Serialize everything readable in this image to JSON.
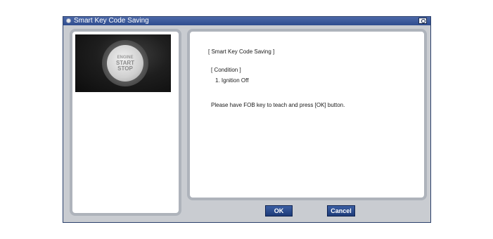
{
  "window": {
    "title": "Smart Key Code Saving"
  },
  "image": {
    "label_line1": "ENGINE",
    "label_line2": "START",
    "label_line3": "STOP"
  },
  "content": {
    "heading": "[ Smart Key Code Saving ]",
    "condition_label": "[ Condition ]",
    "condition_item": "1. Ignition Off",
    "instruction": "Please have FOB key to teach and press [OK] button."
  },
  "buttons": {
    "ok": "OK",
    "cancel": "Cancel"
  },
  "colors": {
    "titlebar": "#2e4c8e",
    "window_bg": "#c9ccd1",
    "button": "#1d3a78"
  }
}
